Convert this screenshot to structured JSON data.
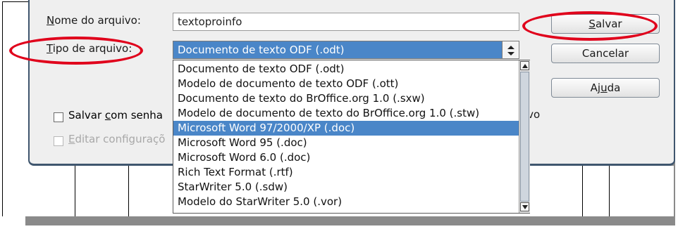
{
  "dialog": {
    "filename_label_accel": "N",
    "filename_label_rest": "ome do arquivo:",
    "filename_value": "textoproinfo",
    "filetype_label_accel": "T",
    "filetype_label_rest": "ipo de arquivo:",
    "filetype_selected": "Documento de texto ODF (.odt)"
  },
  "buttons": {
    "save_accel": "S",
    "save_rest": "alvar",
    "cancel": "Cancelar",
    "help_pre": "Aj",
    "help_accel": "u",
    "help_post": "da"
  },
  "options": {
    "password_pre": "Salvar ",
    "password_accel": "c",
    "password_rest": "om senha",
    "edit_filter_accel": "E",
    "edit_filter_rest": "ditar configuraçõ",
    "trailing_text": "ivo"
  },
  "dropdown": {
    "items": [
      "Documento de texto ODF (.odt)",
      "Modelo de documento de texto ODF (.ott)",
      "Documento de texto do BrOffice.org 1.0 (.sxw)",
      "Modelo de documento de texto do BrOffice.org 1.0 (.stw)",
      "Microsoft Word 97/2000/XP (.doc)",
      "Microsoft Word 95 (.doc)",
      "Microsoft Word 6.0 (.doc)",
      "Rich Text Format (.rtf)",
      "StarWriter 5.0 (.sdw)",
      "Modelo do StarWriter 5.0 (.vor)"
    ],
    "selected_index": 4
  },
  "colors": {
    "selection": "#4a86c8",
    "highlight": "#e0001b",
    "dialog_border": "#3f566e"
  }
}
